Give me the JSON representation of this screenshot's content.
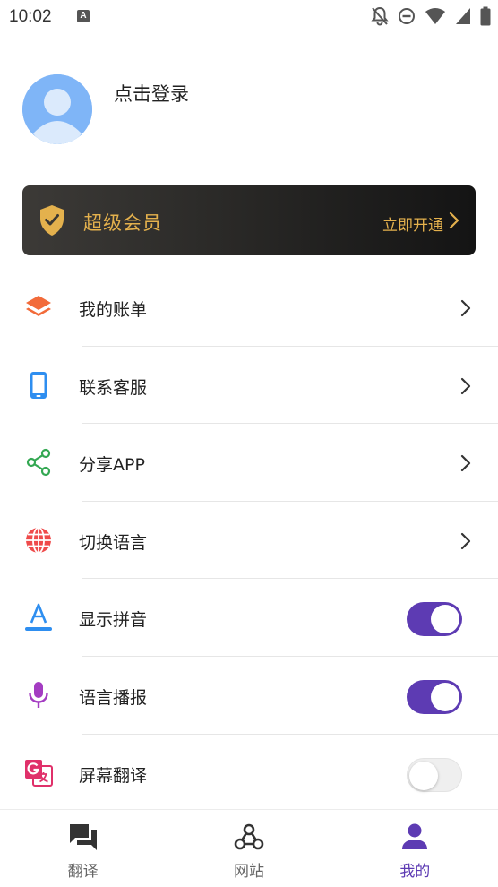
{
  "status_bar": {
    "time": "10:02",
    "badge": "A"
  },
  "profile": {
    "login_text": "点击登录"
  },
  "vip": {
    "title": "超级会员",
    "action": "立即开通",
    "color": "#e4b14d"
  },
  "menu": {
    "items": [
      {
        "label": "我的账单",
        "icon": "layers-icon",
        "type": "link"
      },
      {
        "label": "联系客服",
        "icon": "phone-icon",
        "type": "link"
      },
      {
        "label": "分享APP",
        "icon": "share-icon",
        "type": "link"
      },
      {
        "label": "切换语言",
        "icon": "globe-icon",
        "type": "link"
      },
      {
        "label": "显示拼音",
        "icon": "font-a-icon",
        "type": "toggle",
        "on": true
      },
      {
        "label": "语言播报",
        "icon": "microphone-icon",
        "type": "toggle",
        "on": true
      },
      {
        "label": "屏幕翻译",
        "icon": "translate-icon",
        "type": "toggle",
        "on": false
      }
    ]
  },
  "bottom_nav": {
    "tabs": [
      {
        "label": "翻译",
        "icon": "chat-icon",
        "active": false
      },
      {
        "label": "网站",
        "icon": "webhook-icon",
        "active": false
      },
      {
        "label": "我的",
        "icon": "person-icon",
        "active": true
      }
    ]
  },
  "colors": {
    "accent": "#5d3bb3",
    "vip_gold": "#e4b14d"
  }
}
